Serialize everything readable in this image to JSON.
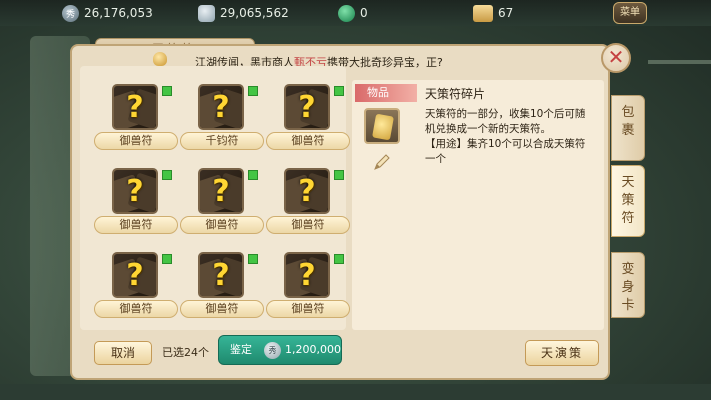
{
  "currencies": {
    "jade_coin": "26,176,053",
    "silver": "29,065,562",
    "green_token": "0",
    "ticket": "67"
  },
  "menu_button": "菜单",
  "window_tab": "天策符",
  "marquee": {
    "prefix": "江湖传闻，黑市商人",
    "highlight": "甄不亏",
    "suffix": "携带大批奇珍异宝，正?"
  },
  "grid_items": [
    {
      "label": "御兽符",
      "checked": true
    },
    {
      "label": "千钧符",
      "checked": true
    },
    {
      "label": "御兽符",
      "checked": true
    },
    {
      "label": "御兽符",
      "checked": true
    },
    {
      "label": "御兽符",
      "checked": true
    },
    {
      "label": "御兽符",
      "checked": true
    },
    {
      "label": "御兽符",
      "checked": true
    },
    {
      "label": "御兽符",
      "checked": true
    },
    {
      "label": "御兽符",
      "checked": true
    }
  ],
  "unknown_mark": "?",
  "detail": {
    "category": "物品",
    "title": "天策符碎片",
    "line1": "天策符的一部分，收集10个后可随机兑换成一个新的天策符。",
    "line2": "【用途】集齐10个可以合成天策符一个"
  },
  "footer": {
    "cancel": "取消",
    "selected": "已选24个",
    "appraise": "鉴定",
    "coin_glyph": "秀",
    "cost": "1,200,000",
    "tianyance": "天演策"
  },
  "close_glyph": "✕",
  "side_tabs": [
    {
      "id": "bag",
      "chars": [
        "包",
        "裹"
      ]
    },
    {
      "id": "tiance",
      "chars": [
        "天",
        "策",
        "符"
      ]
    },
    {
      "id": "bianshen",
      "chars": [
        "变",
        "身",
        "卡"
      ]
    }
  ]
}
